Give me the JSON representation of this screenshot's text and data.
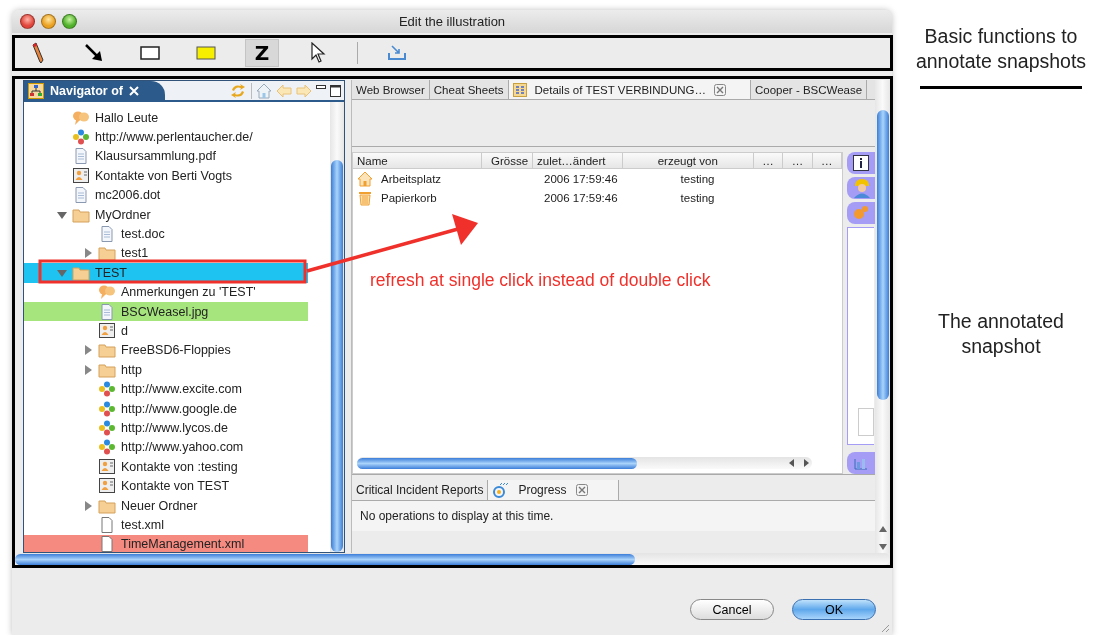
{
  "window": {
    "title": "Edit the illustration"
  },
  "toolbar": {
    "tools": [
      {
        "kind": "pencil",
        "selected": false
      },
      {
        "kind": "arrow",
        "selected": false
      },
      {
        "kind": "rectangle",
        "selected": false
      },
      {
        "kind": "highlight",
        "selected": false
      },
      {
        "kind": "text",
        "label": "Z",
        "selected": true
      },
      {
        "kind": "pointer",
        "selected": false
      }
    ],
    "actions": [
      {
        "kind": "import"
      }
    ]
  },
  "navigator": {
    "title": "Navigator of",
    "tree": [
      {
        "label": "Hallo Leute",
        "kind": "annotation",
        "selected": false
      },
      {
        "label": "http://www.perlentaucher.de/",
        "kind": "link",
        "selected": false
      },
      {
        "label": "Klausursammlung.pdf",
        "kind": "document",
        "selected": false
      },
      {
        "label": "Kontakte von Berti Vogts",
        "kind": "contacts",
        "selected": false
      },
      {
        "label": "mc2006.dot",
        "kind": "document",
        "selected": false
      },
      {
        "label": "MyOrdner",
        "kind": "folder",
        "selected": false,
        "expanded": true,
        "children": [
          {
            "label": "test.doc",
            "kind": "document",
            "selected": false
          },
          {
            "label": "test1",
            "kind": "folder",
            "selected": false,
            "expanded": false
          }
        ]
      },
      {
        "label": "TEST",
        "kind": "folder",
        "selected": true,
        "expanded": true,
        "children": [
          {
            "label": "Anmerkungen zu 'TEST'",
            "kind": "annotation",
            "selected": false
          },
          {
            "label": "BSCWeasel.jpg",
            "kind": "document",
            "selected": false,
            "color": "#a6e57d"
          },
          {
            "label": "d",
            "kind": "contacts",
            "selected": false
          },
          {
            "label": "FreeBSD6-Floppies",
            "kind": "folder",
            "selected": false,
            "expanded": false
          },
          {
            "label": "http",
            "kind": "folder",
            "selected": false,
            "expanded": false
          },
          {
            "label": "http://www.excite.com",
            "kind": "link",
            "selected": false
          },
          {
            "label": "http://www.google.de",
            "kind": "link",
            "selected": false
          },
          {
            "label": "http://www.lycos.de",
            "kind": "link",
            "selected": false
          },
          {
            "label": "http://www.yahoo.com",
            "kind": "link",
            "selected": false
          },
          {
            "label": "Kontakte von :testing",
            "kind": "contacts",
            "selected": false
          },
          {
            "label": "Kontakte von TEST",
            "kind": "contacts",
            "selected": false
          },
          {
            "label": "Neuer Ordner",
            "kind": "folder",
            "selected": false,
            "expanded": false
          },
          {
            "label": "test.xml",
            "kind": "blank",
            "selected": false
          },
          {
            "label": "TimeManagement.xml",
            "kind": "blank",
            "selected": false,
            "color": "#f58a80"
          }
        ]
      }
    ]
  },
  "editor": {
    "tabs": [
      {
        "label": "Web Browser",
        "selected": false
      },
      {
        "label": "Cheat Sheets",
        "selected": false
      },
      {
        "label": "Details of TEST VERBINDUNG…",
        "selected": true
      },
      {
        "label": "Cooper - BSCWease",
        "selected": false
      }
    ],
    "table": {
      "columns": [
        "Name",
        "Grösse",
        "zulet…ändert",
        "erzeugt von",
        "…",
        "…",
        "…"
      ],
      "rows": [
        {
          "kind": "home",
          "name": "Arbeitsplatz",
          "modified": "2006 17:59:46",
          "created_by": "testing"
        },
        {
          "kind": "trash",
          "name": "Papierkorb",
          "modified": "2006 17:59:46",
          "created_by": "testing"
        }
      ]
    }
  },
  "bottom_panel": {
    "tabs": [
      {
        "label": "Critical Incident Reports",
        "selected": false
      },
      {
        "label": "Progress",
        "selected": true
      }
    ],
    "message": "No operations to display at this time."
  },
  "buttons": [
    {
      "label": "Cancel",
      "default": false
    },
    {
      "label": "OK",
      "default": true
    }
  ],
  "annotations": {
    "callout": "refresh at single click instead of double click",
    "notes": [
      "Basic functions to annotate snapshots",
      "The annotated snapshot"
    ]
  }
}
